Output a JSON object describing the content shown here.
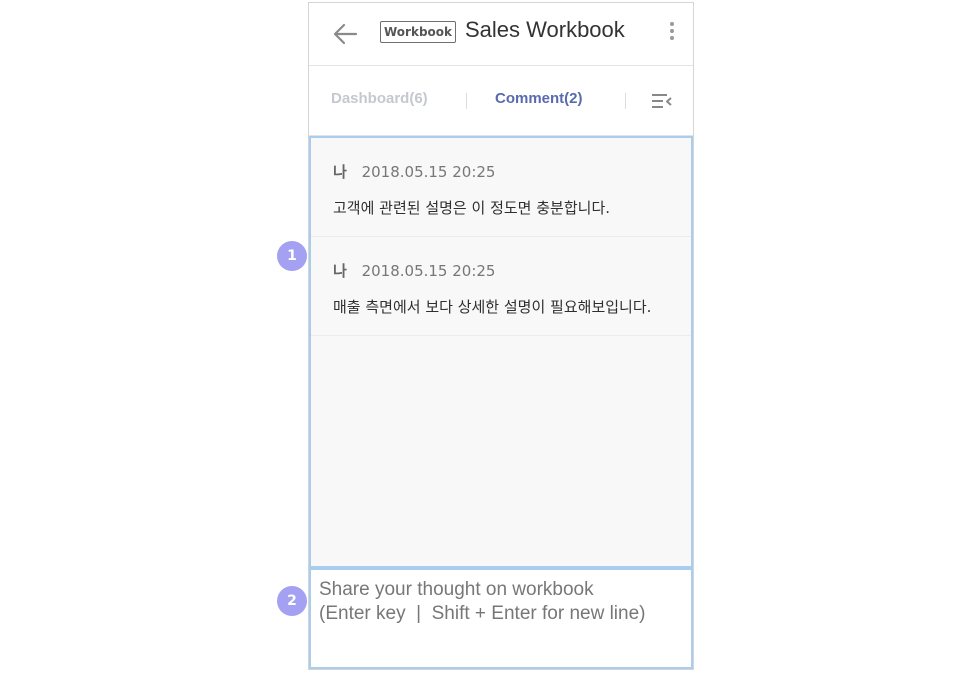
{
  "header": {
    "badge": "Workbook",
    "title": "Sales Workbook",
    "icons": {
      "back": "arrow-left-icon",
      "more": "more-vertical-icon"
    }
  },
  "tabs": [
    {
      "label": "Dashboard(6)",
      "active": false
    },
    {
      "label": "Comment(2)",
      "active": true
    }
  ],
  "tab_list_icon": "list-collapse-icon",
  "comments": [
    {
      "author": "나",
      "time": "2018.05.15 20:25",
      "text": "고객에 관련된 설명은 이 정도면 충분합니다."
    },
    {
      "author": "나",
      "time": "2018.05.15 20:25",
      "text": "매출 측면에서 보다 상세한 설명이 필요해보입니다."
    }
  ],
  "input": {
    "placeholder": "Share your thought on workbook\n(Enter key  |  Shift + Enter for new line)",
    "value": ""
  },
  "callouts": [
    "1",
    "2"
  ],
  "colors": {
    "accent": "#5a6ab1",
    "highlight_border": "#a9cdef",
    "callout": "#a4a1f2",
    "inactive_tab": "#c5c8cf"
  }
}
